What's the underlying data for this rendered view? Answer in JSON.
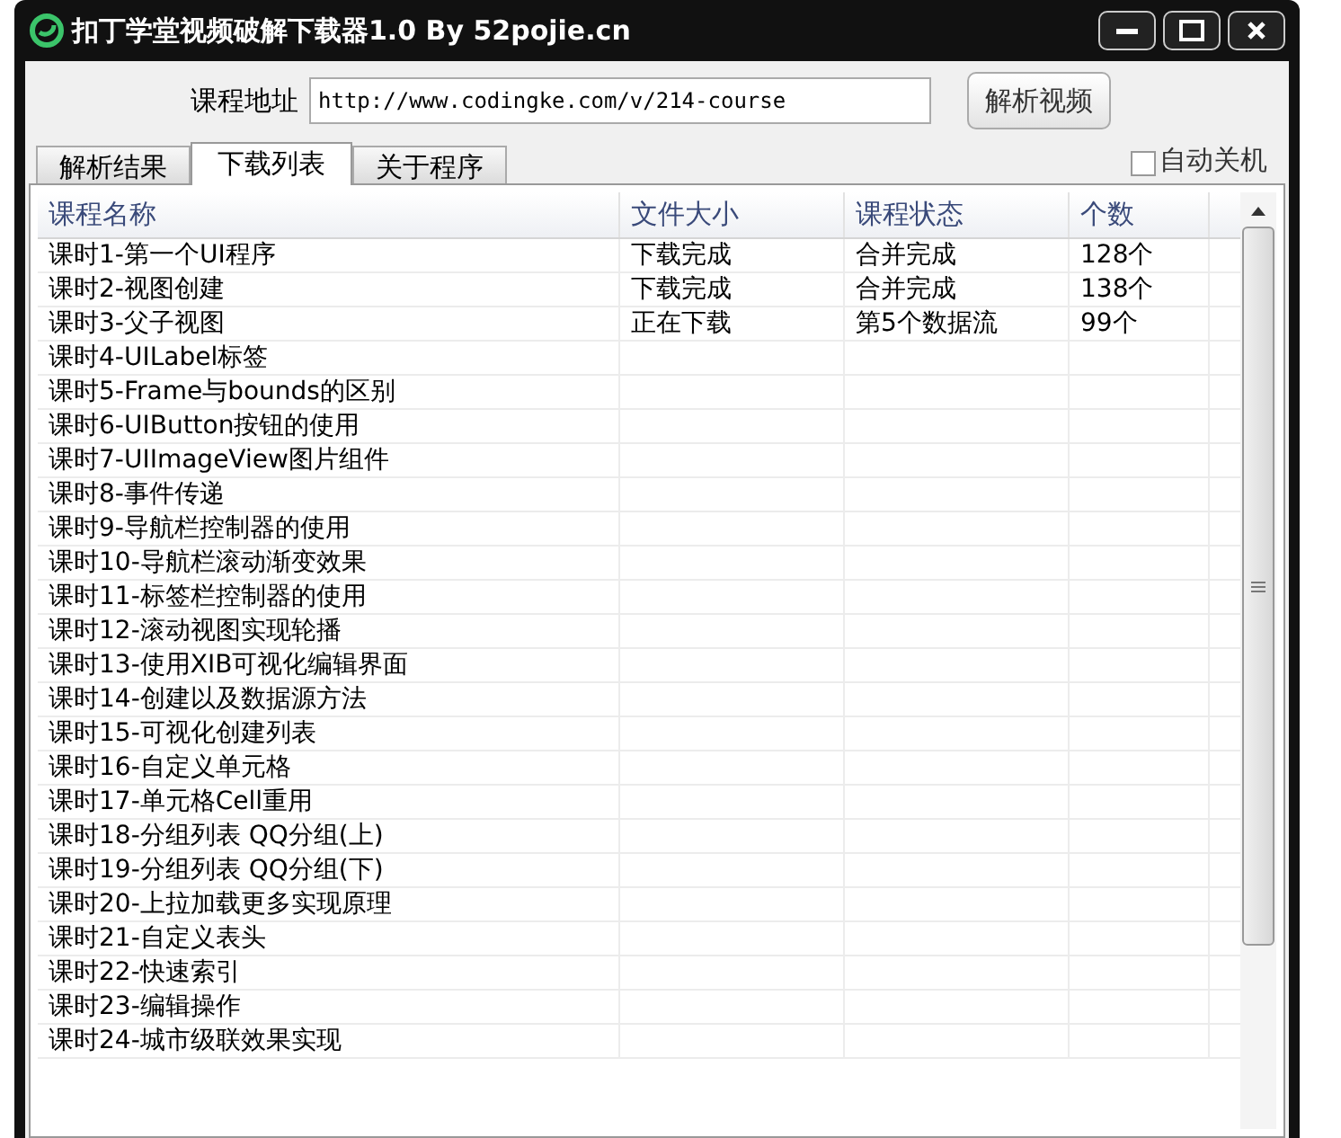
{
  "window": {
    "title": "扣丁学堂视频破解下载器1.0 By 52pojie.cn"
  },
  "url_label": "课程地址",
  "url_value": "http://www.codingke.com/v/214-course",
  "parse_button": "解析视频",
  "tabs": [
    {
      "label": "解析结果",
      "selected": false
    },
    {
      "label": "下载列表",
      "selected": true
    },
    {
      "label": "关于程序",
      "selected": false
    }
  ],
  "auto_shutdown": {
    "label": "自动关机",
    "checked": false
  },
  "table": {
    "columns": [
      "课程名称",
      "文件大小",
      "课程状态",
      "个数"
    ],
    "rows": [
      [
        "课时1-第一个UI程序",
        "下载完成",
        "合并完成",
        "128个"
      ],
      [
        "课时2-视图创建",
        "下载完成",
        "合并完成",
        "138个"
      ],
      [
        "课时3-父子视图",
        "正在下载",
        "第5个数据流",
        "99个"
      ],
      [
        "课时4-UILabel标签",
        "",
        "",
        ""
      ],
      [
        "课时5-Frame与bounds的区别",
        "",
        "",
        ""
      ],
      [
        "课时6-UIButton按钮的使用",
        "",
        "",
        ""
      ],
      [
        "课时7-UIImageView图片组件",
        "",
        "",
        ""
      ],
      [
        "课时8-事件传递",
        "",
        "",
        ""
      ],
      [
        "课时9-导航栏控制器的使用",
        "",
        "",
        ""
      ],
      [
        "课时10-导航栏滚动渐变效果",
        "",
        "",
        ""
      ],
      [
        "课时11-标签栏控制器的使用",
        "",
        "",
        ""
      ],
      [
        "课时12-滚动视图实现轮播",
        "",
        "",
        ""
      ],
      [
        "课时13-使用XIB可视化编辑界面",
        "",
        "",
        ""
      ],
      [
        "课时14-创建以及数据源方法",
        "",
        "",
        ""
      ],
      [
        "课时15-可视化创建列表",
        "",
        "",
        ""
      ],
      [
        "课时16-自定义单元格",
        "",
        "",
        ""
      ],
      [
        "课时17-单元格Cell重用",
        "",
        "",
        ""
      ],
      [
        "课时18-分组列表 QQ分组(上)",
        "",
        "",
        ""
      ],
      [
        "课时19-分组列表 QQ分组(下)",
        "",
        "",
        ""
      ],
      [
        "课时20-上拉加载更多实现原理",
        "",
        "",
        ""
      ],
      [
        "课时21-自定义表头",
        "",
        "",
        ""
      ],
      [
        "课时22-快速索引",
        "",
        "",
        ""
      ],
      [
        "课时23-编辑操作",
        "",
        "",
        ""
      ],
      [
        "课时24-城市级联效果实现",
        "",
        "",
        ""
      ]
    ]
  }
}
